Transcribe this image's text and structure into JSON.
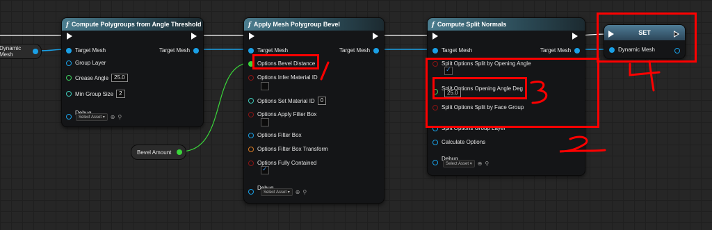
{
  "nodes": {
    "angle": {
      "title": "Compute Polygroups from Angle Threshold",
      "target_mesh_in": "Target Mesh",
      "target_mesh_out": "Target Mesh",
      "group_layer": "Group Layer",
      "crease_angle": "Crease Angle",
      "crease_angle_value": "25.0",
      "min_group_size": "Min Group Size",
      "min_group_size_value": "2",
      "debug": "Debug",
      "select_asset": "Select Asset"
    },
    "bevel": {
      "title": "Apply Mesh Polygroup Bevel",
      "target_mesh_in": "Target Mesh",
      "target_mesh_out": "Target Mesh",
      "options_bevel_distance": "Options Bevel Distance",
      "options_infer_material_id": "Options Infer Material ID",
      "options_set_material_id": "Options Set Material ID",
      "options_set_material_id_value": "0",
      "options_apply_filter_box": "Options Apply Filter Box",
      "options_filter_box": "Options Filter Box",
      "options_filter_box_transform": "Options Filter Box Transform",
      "options_fully_contained": "Options Fully Contained",
      "debug": "Debug",
      "select_asset": "Select Asset"
    },
    "split": {
      "title": "Compute Split Normals",
      "target_mesh_in": "Target Mesh",
      "target_mesh_out": "Target Mesh",
      "split_by_opening_angle": "Split Options Split by Opening Angle",
      "opening_angle_deg": "Split Options Opening Angle Deg",
      "opening_angle_deg_value": "25.0",
      "split_by_face_group": "Split Options Split by Face Group",
      "group_layer": "Split Options Group Layer",
      "calculate_options": "Calculate Options",
      "debug": "Debug",
      "select_asset": "Select Asset"
    },
    "set": {
      "title": "SET",
      "dynamic_mesh": "Dynamic Mesh"
    },
    "dynamic_mesh_var": {
      "label": "Dynamic Mesh"
    },
    "bevel_amount_var": {
      "label": "Bevel Amount"
    }
  },
  "annotations": {
    "one": "1",
    "two": "2",
    "three": "3",
    "four": "4"
  },
  "icons": {
    "function": "f",
    "exec_in": "exec-pin-icon",
    "reroute": "magnifier-icon"
  },
  "colors": {
    "annotation": "#ff0000",
    "header_start": "#4b7d8f",
    "pin_mesh": "#1aa0e6",
    "pin_float": "#3ad63a",
    "wire_exec": "#ffffff"
  }
}
